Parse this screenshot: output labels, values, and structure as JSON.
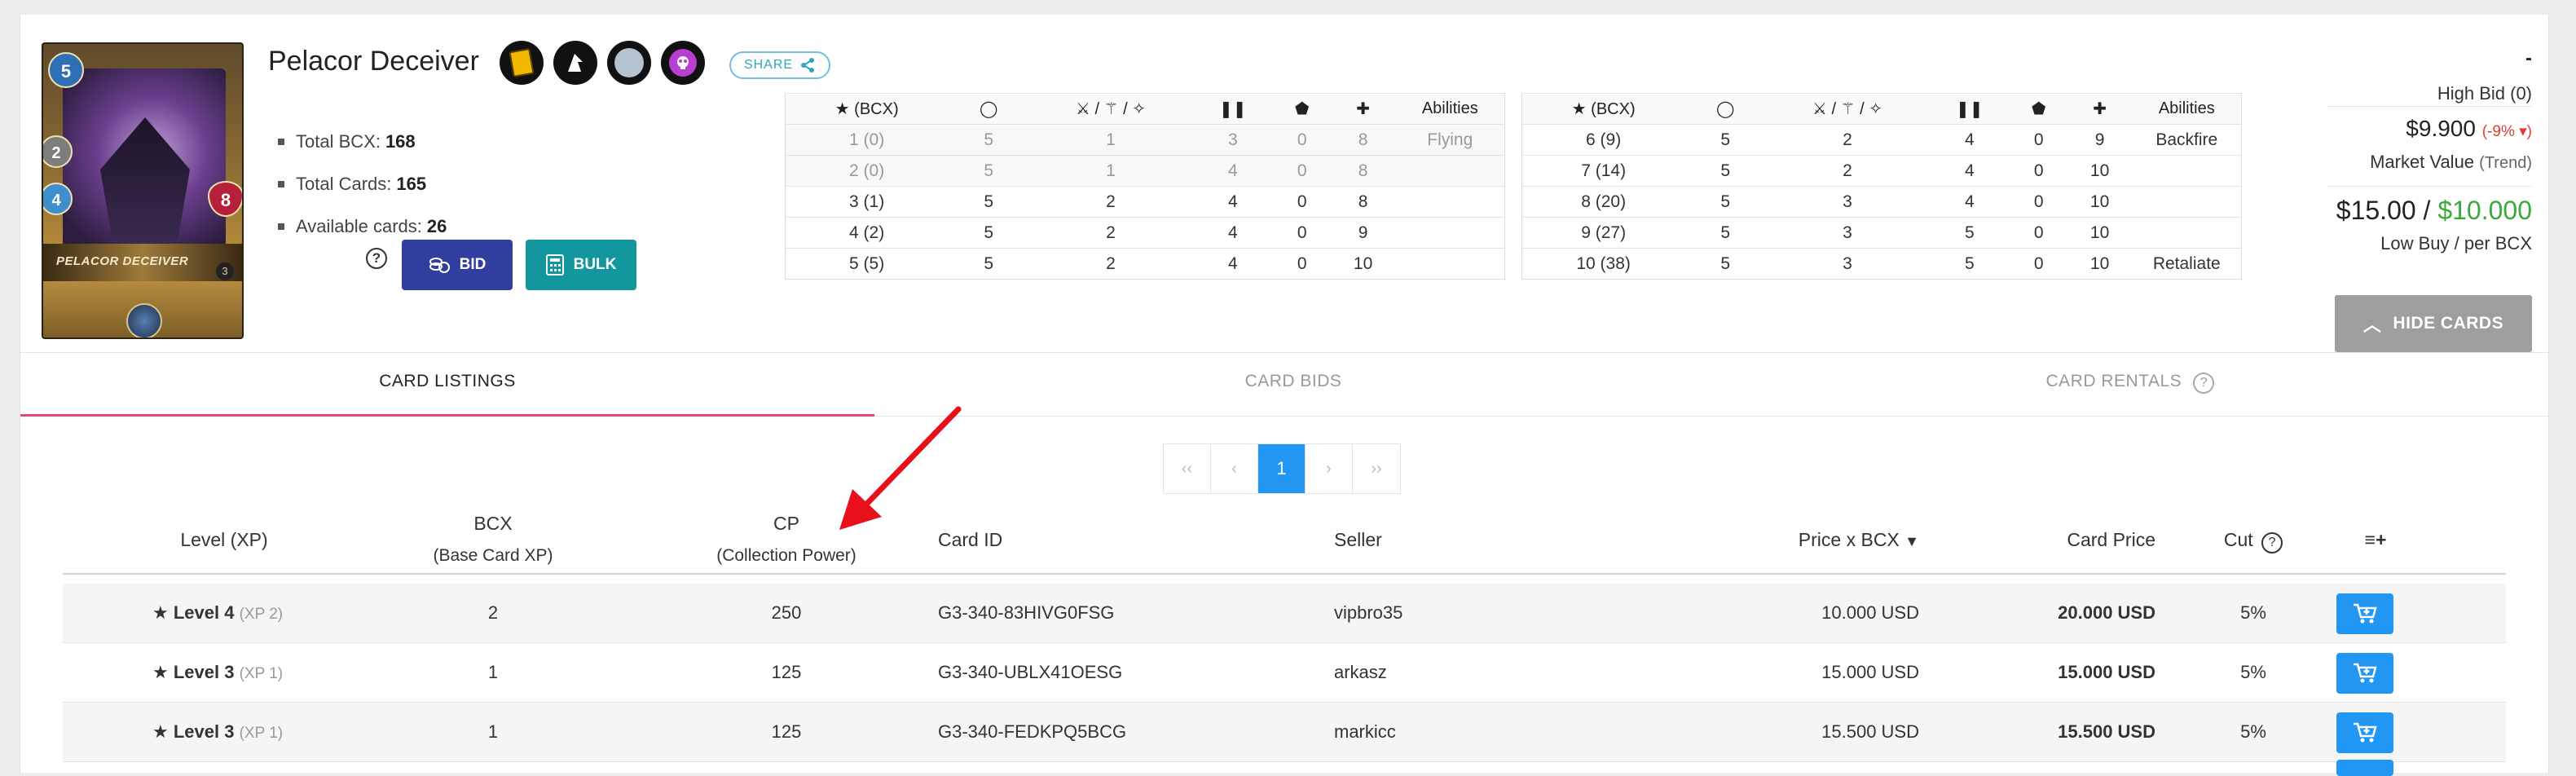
{
  "card": {
    "name": "Pelacor Deceiver",
    "image_name": "PELACOR DECEIVER",
    "mana": "5",
    "attack": "2",
    "speed": "4",
    "health": "8",
    "level": "3",
    "element_icons": [
      "card-type-icon",
      "dark-splinter-icon",
      "neutral-icon",
      "death-icon"
    ]
  },
  "share_label": "SHARE",
  "info": [
    {
      "label": "Total BCX:",
      "value": "168"
    },
    {
      "label": "Total Cards:",
      "value": "165"
    },
    {
      "label": "Available cards:",
      "value": "26"
    }
  ],
  "buttons": {
    "bid": "BID",
    "bulk": "BULK",
    "help": "?"
  },
  "stats_headers": {
    "level": "(BCX)",
    "mana": "mana-icon",
    "attack": "attack-icons",
    "speed": "speed-icon",
    "armor": "armor-icon",
    "health": "health-icon",
    "abilities": "Abilities"
  },
  "stats_left": [
    {
      "lvl": "1 (0)",
      "mana": "5",
      "atk": "1",
      "spd": "3",
      "arm": "0",
      "hp": "8",
      "ab": "Flying",
      "past": true
    },
    {
      "lvl": "2 (0)",
      "mana": "5",
      "atk": "1",
      "spd": "4",
      "arm": "0",
      "hp": "8",
      "ab": "",
      "past": true
    },
    {
      "lvl": "3 (1)",
      "mana": "5",
      "atk": "2",
      "spd": "4",
      "arm": "0",
      "hp": "8",
      "ab": "",
      "past": false
    },
    {
      "lvl": "4 (2)",
      "mana": "5",
      "atk": "2",
      "spd": "4",
      "arm": "0",
      "hp": "9",
      "ab": "",
      "past": false
    },
    {
      "lvl": "5 (5)",
      "mana": "5",
      "atk": "2",
      "spd": "4",
      "arm": "0",
      "hp": "10",
      "ab": "",
      "past": false
    }
  ],
  "stats_right": [
    {
      "lvl": "6 (9)",
      "mana": "5",
      "atk": "2",
      "spd": "4",
      "arm": "0",
      "hp": "9",
      "ab": "Backfire"
    },
    {
      "lvl": "7 (14)",
      "mana": "5",
      "atk": "2",
      "spd": "4",
      "arm": "0",
      "hp": "10",
      "ab": ""
    },
    {
      "lvl": "8 (20)",
      "mana": "5",
      "atk": "3",
      "spd": "4",
      "arm": "0",
      "hp": "10",
      "ab": ""
    },
    {
      "lvl": "9 (27)",
      "mana": "5",
      "atk": "3",
      "spd": "5",
      "arm": "0",
      "hp": "10",
      "ab": ""
    },
    {
      "lvl": "10 (38)",
      "mana": "5",
      "atk": "3",
      "spd": "5",
      "arm": "0",
      "hp": "10",
      "ab": "Retaliate"
    }
  ],
  "market": {
    "high_bid_value": "-",
    "high_bid_label": "High Bid (0)",
    "market_value": "$9.900",
    "market_change": "(-9%",
    "market_change_close": ")",
    "market_value_label": "Market Value",
    "market_value_trend": "(Trend)",
    "low_buy": "$15.00 /",
    "per_bcx": "$10.000",
    "low_buy_label": "Low Buy / per BCX",
    "hide_cards": "HIDE CARDS",
    "accent_green": "#3aa83a",
    "accent_red": "#e53935"
  },
  "tabs": [
    {
      "label": "CARD LISTINGS",
      "active": true
    },
    {
      "label": "CARD BIDS",
      "active": false
    },
    {
      "label": "CARD RENTALS",
      "active": false
    }
  ],
  "pager": {
    "first": "‹‹",
    "prev": "‹",
    "current": "1",
    "next": "›",
    "last": "››"
  },
  "listing_headers": {
    "level": "Level (XP)",
    "bcx": "BCX",
    "bcx_sub": "(Base Card XP)",
    "cp": "CP",
    "cp_sub": "(Collection Power)",
    "card_id": "Card ID",
    "seller": "Seller",
    "price_bcx": "Price x BCX",
    "card_price": "Card Price",
    "cut": "Cut"
  },
  "listings": [
    {
      "level": "Level 4",
      "xp": "(XP 2)",
      "bcx": "2",
      "cp": "250",
      "id": "G3-340-83HIVG0FSG",
      "seller": "vipbro35",
      "price_bcx": "10.000 USD",
      "price": "20.000 USD",
      "cut": "5%"
    },
    {
      "level": "Level 3",
      "xp": "(XP 1)",
      "bcx": "1",
      "cp": "125",
      "id": "G3-340-UBLX41OESG",
      "seller": "arkasz",
      "price_bcx": "15.000 USD",
      "price": "15.000 USD",
      "cut": "5%"
    },
    {
      "level": "Level 3",
      "xp": "(XP 1)",
      "bcx": "1",
      "cp": "125",
      "id": "G3-340-FEDKPQ5BCG",
      "seller": "markicc",
      "price_bcx": "15.500 USD",
      "price": "15.500 USD",
      "cut": "5%"
    }
  ]
}
